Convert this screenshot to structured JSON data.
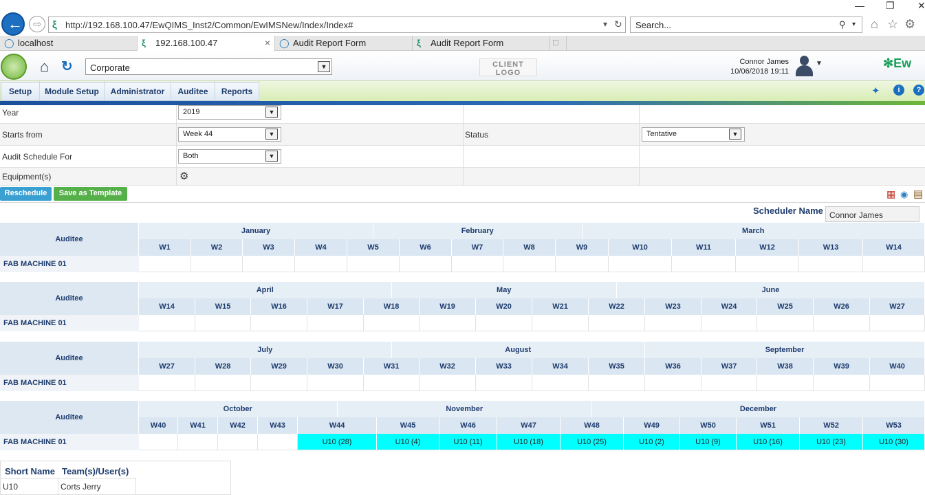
{
  "browser": {
    "url": "http://192.168.100.47/EwQIMS_Inst2/Common/EwIMSNew/Index/Index#",
    "search_placeholder": "Search...",
    "tabs": [
      {
        "label": "localhost"
      },
      {
        "label": "192.168.100.47"
      },
      {
        "label": "Audit Report Form"
      },
      {
        "label": "Audit Report Form"
      }
    ]
  },
  "header": {
    "org_select": "Corporate",
    "client_logo": "CLIENT LOGO",
    "user_name": "Connor James",
    "user_datetime": "10/06/2018 19:11",
    "brand": "Ew"
  },
  "menu": {
    "items": [
      "Setup",
      "Module Setup",
      "Administrator",
      "Auditee",
      "Reports"
    ]
  },
  "form": {
    "year_label": "Year",
    "year_value": "2019",
    "starts_label": "Starts from",
    "starts_value": "Week 44",
    "status_label": "Status",
    "status_value": "Tentative",
    "schedule_for_label": "Audit Schedule For",
    "schedule_for_value": "Both",
    "equipment_label": "Equipment(s)"
  },
  "actions": {
    "reschedule": "Reschedule",
    "save_template": "Save as Template"
  },
  "scheduler": {
    "label": "Scheduler Name",
    "value": "Connor James"
  },
  "schedule": {
    "auditee_header": "Auditee",
    "row_label": "FAB MACHINE 01",
    "quarters": [
      {
        "months": [
          "January",
          "February",
          "March"
        ],
        "weeks": [
          "W1",
          "W2",
          "W3",
          "W4",
          "W5",
          "W6",
          "W7",
          "W8",
          "W9",
          "W10",
          "W11",
          "W12",
          "W13",
          "W14"
        ],
        "cells": [
          "",
          "",
          "",
          "",
          "",
          "",
          "",
          "",
          "",
          "",
          "",
          "",
          "",
          ""
        ]
      },
      {
        "months": [
          "April",
          "May",
          "June"
        ],
        "weeks": [
          "W14",
          "W15",
          "W16",
          "W17",
          "W18",
          "W19",
          "W20",
          "W21",
          "W22",
          "W23",
          "W24",
          "W25",
          "W26",
          "W27"
        ],
        "cells": [
          "",
          "",
          "",
          "",
          "",
          "",
          "",
          "",
          "",
          "",
          "",
          "",
          "",
          ""
        ]
      },
      {
        "months": [
          "July",
          "August",
          "September"
        ],
        "weeks": [
          "W27",
          "W28",
          "W29",
          "W30",
          "W31",
          "W32",
          "W33",
          "W34",
          "W35",
          "W36",
          "W37",
          "W38",
          "W39",
          "W40"
        ],
        "cells": [
          "",
          "",
          "",
          "",
          "",
          "",
          "",
          "",
          "",
          "",
          "",
          "",
          "",
          ""
        ]
      },
      {
        "months": [
          "October",
          "November",
          "December"
        ],
        "weeks": [
          "W40",
          "W41",
          "W42",
          "W43",
          "W44",
          "W45",
          "W46",
          "W47",
          "W48",
          "W49",
          "W50",
          "W51",
          "W52",
          "W53"
        ],
        "cells": [
          "",
          "",
          "",
          "",
          "U10 (28)",
          "U10 (4)",
          "U10 (11)",
          "U10 (18)",
          "U10 (25)",
          "U10 (2)",
          "U10 (9)",
          "U10 (16)",
          "U10 (23)",
          "U10 (30)"
        ]
      }
    ],
    "highlight_color": "#00ffff"
  },
  "legend": {
    "short_name_header": "Short Name",
    "team_header": "Team(s)/User(s)",
    "short_name": "U10",
    "team": "Corts Jerry"
  }
}
